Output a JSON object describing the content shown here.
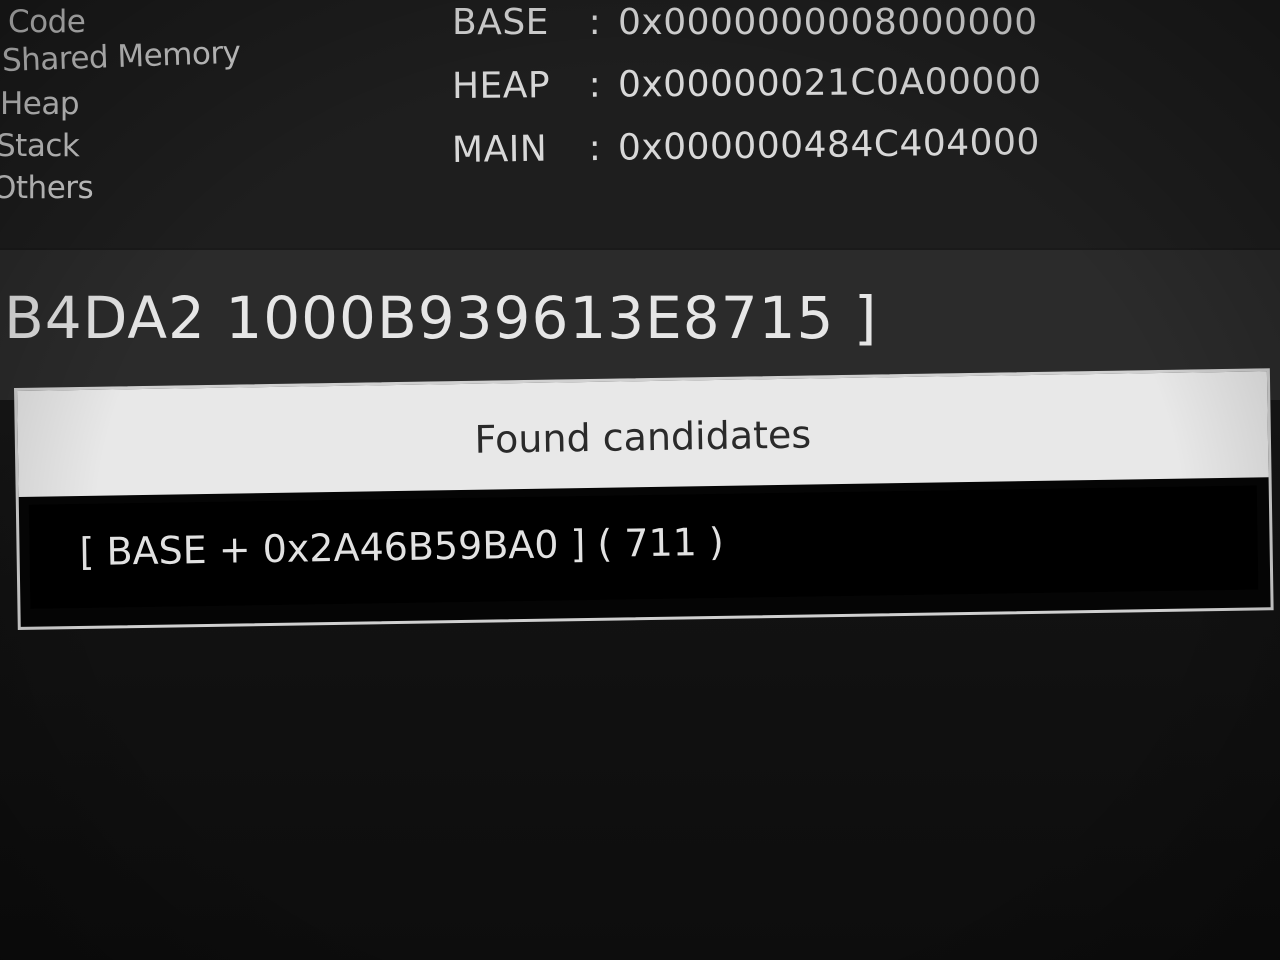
{
  "memory_regions": [
    "Code",
    "Shared Memory",
    "Heap",
    "Stack",
    "Others"
  ],
  "addresses": [
    {
      "label": "BASE",
      "separator": ":",
      "value": "0x0000000008000000"
    },
    {
      "label": "HEAP",
      "separator": ":",
      "value": "0x00000021C0A00000"
    },
    {
      "label": "MAIN",
      "separator": ":",
      "value": "0x000000484C404000"
    }
  ],
  "value_bar": {
    "text": "B4DA2 1000B939613E8715 ]"
  },
  "dialog": {
    "title": "Found candidates",
    "candidates": [
      {
        "text": "[ BASE + 0x2A46B59BA0 ]  ( 711 )"
      }
    ]
  }
}
